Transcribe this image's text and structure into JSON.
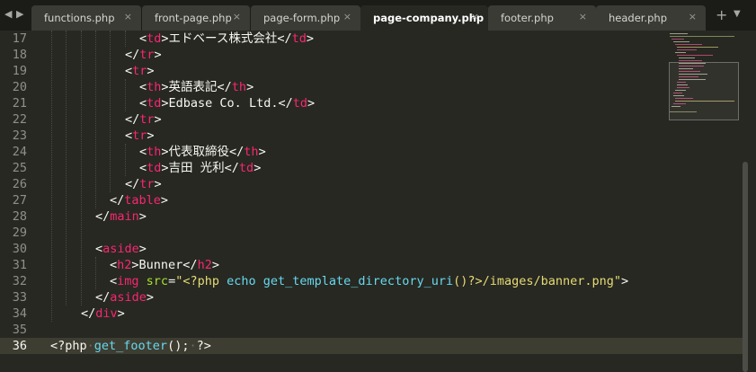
{
  "tabs": [
    {
      "label": "functions.php",
      "active": false
    },
    {
      "label": "front-page.php",
      "active": false
    },
    {
      "label": "page-form.php",
      "active": false
    },
    {
      "label": "page-company.php",
      "active": true
    },
    {
      "label": "footer.php",
      "active": false
    },
    {
      "label": "header.php",
      "active": false
    }
  ],
  "tab_close_glyph": "×",
  "tab_add_glyph": "+",
  "tab_menu_glyph": "▼",
  "nav": {
    "left_glyph": "◀",
    "right_glyph": "▶"
  },
  "editor": {
    "current_line": "36",
    "lines": [
      {
        "num": "17",
        "t0": "<",
        "t1": "td",
        "t2": ">エドベース株式会社</",
        "t3": "td",
        "t4": ">"
      },
      {
        "num": "18",
        "t0": "</",
        "t1": "tr",
        "t2": ">"
      },
      {
        "num": "19",
        "t0": "<",
        "t1": "tr",
        "t2": ">"
      },
      {
        "num": "20",
        "t0": "<",
        "t1": "th",
        "t2": ">英語表記</",
        "t3": "th",
        "t4": ">"
      },
      {
        "num": "21",
        "t0": "<",
        "t1": "td",
        "t2": ">Edbase Co. Ltd.</",
        "t3": "td",
        "t4": ">"
      },
      {
        "num": "22",
        "t0": "</",
        "t1": "tr",
        "t2": ">"
      },
      {
        "num": "23",
        "t0": "<",
        "t1": "tr",
        "t2": ">"
      },
      {
        "num": "24",
        "t0": "<",
        "t1": "th",
        "t2": ">代表取締役</",
        "t3": "th",
        "t4": ">"
      },
      {
        "num": "25",
        "t0": "<",
        "t1": "td",
        "t2": ">吉田 光利</",
        "t3": "td",
        "t4": ">"
      },
      {
        "num": "26",
        "t0": "</",
        "t1": "tr",
        "t2": ">"
      },
      {
        "num": "27",
        "t0": "</",
        "t1": "table",
        "t2": ">"
      },
      {
        "num": "28",
        "t0": "</",
        "t1": "main",
        "t2": ">"
      },
      {
        "num": "29"
      },
      {
        "num": "30",
        "t0": "<",
        "t1": "aside",
        "t2": ">"
      },
      {
        "num": "31",
        "t0": "<",
        "t1": "h2",
        "t2": ">Bunner</",
        "t3": "h2",
        "t4": ">"
      },
      {
        "num": "32",
        "t0": "<",
        "t1": "img",
        "t2": " ",
        "t3": "src",
        "t4": "=",
        "t5": "\"<?php ",
        "t6": "echo",
        "t7": " ",
        "t8": "get_template_directory_uri",
        "t9": "()?>/images/banner.png\"",
        "t10": ">"
      },
      {
        "num": "33",
        "t0": "</",
        "t1": "aside",
        "t2": ">"
      },
      {
        "num": "34",
        "t0": "</",
        "t1": "div",
        "t2": ">"
      },
      {
        "num": "35"
      },
      {
        "num": "36",
        "t0": "<?php",
        "t1": "·",
        "t2": "get_footer",
        "t3": "();",
        "t4": "·",
        "t5": "?>"
      }
    ]
  },
  "colors": {
    "background": "#272822",
    "tag": "#f92672",
    "attribute": "#a6e22e",
    "string": "#e6db74",
    "function": "#66d9ef",
    "text": "#f8f8f2"
  }
}
